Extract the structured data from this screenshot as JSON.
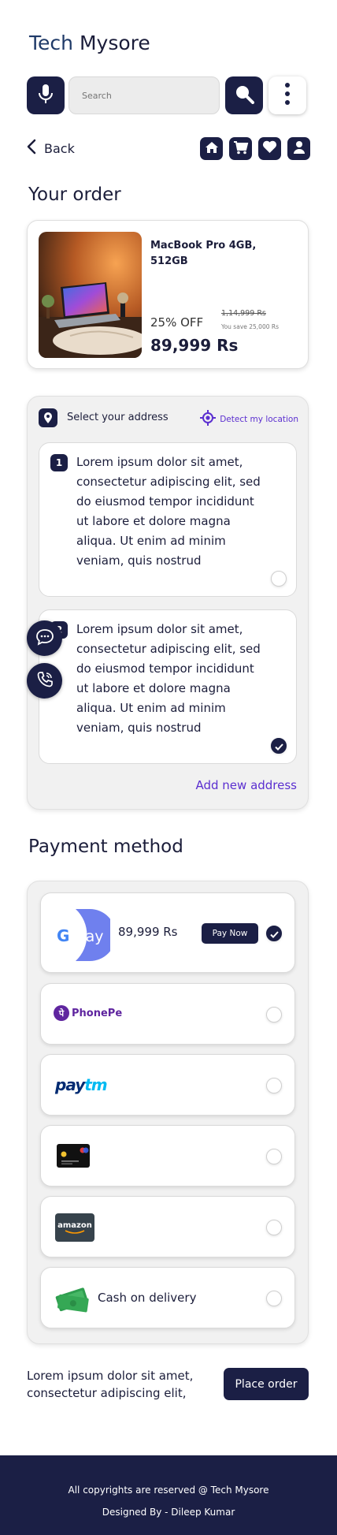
{
  "brand": {
    "part1": "Tech",
    "part2": "Mysore"
  },
  "search": {
    "placeholder": "Search"
  },
  "nav": {
    "back_label": "Back"
  },
  "order": {
    "title": "Your order",
    "product_name": "MacBook Pro 4GB, 512GB",
    "discount": "25% OFF",
    "mrp": "1,14,999 Rs",
    "save_text": "You save 25,000 Rs",
    "price": "89,999 Rs"
  },
  "address": {
    "title": "Select your address",
    "detect_label": "Detect my location",
    "items": [
      {
        "number": "1",
        "text": "Lorem ipsum dolor sit amet, consectetur adipiscing elit, sed do eiusmod tempor incididunt ut labore et dolore magna aliqua. Ut enim ad minim veniam, quis nostrud",
        "selected": false
      },
      {
        "number": "2",
        "text": "Lorem ipsum dolor sit amet, consectetur adipiscing elit, sed do eiusmod tempor incididunt ut labore et dolore magna aliqua. Ut enim ad minim veniam, quis nostrud",
        "selected": true
      }
    ],
    "add_new_label": "Add new address"
  },
  "payment": {
    "title": "Payment method",
    "gpay": {
      "g_letter": "G",
      "pay_text": "Pay",
      "amount": "89,999 Rs",
      "pay_now_label": "Pay Now",
      "selected": true
    },
    "phonepe": {
      "label": "PhonePe",
      "glyph": "पे",
      "selected": false
    },
    "paytm": {
      "pay": "pay",
      "tm": "tm",
      "selected": false
    },
    "card": {
      "selected": false
    },
    "amazon": {
      "label": "amazon",
      "selected": false
    },
    "cod": {
      "label": "Cash on delivery",
      "selected": false
    }
  },
  "summary": {
    "note": "Lorem ipsum dolor sit amet, consectetur adipiscing elit,",
    "place_order_label": "Place order"
  },
  "footer": {
    "line1": "All copyrights are reserved @ Tech Mysore",
    "line2": "Designed By - Dileep Kumar"
  },
  "colors": {
    "primary": "#1b1f45",
    "accent": "#5b2fd0",
    "brand": "#1f3a68",
    "panel": "#f1f1f1"
  }
}
